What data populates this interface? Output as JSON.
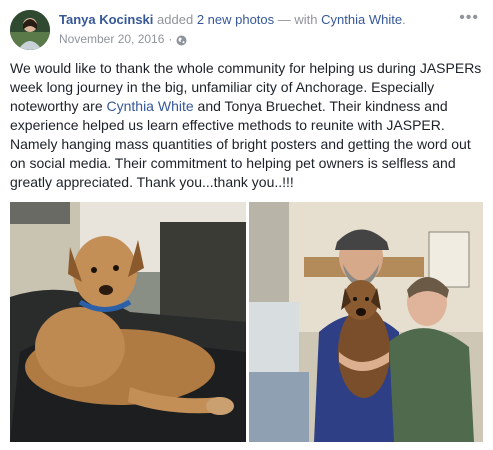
{
  "post": {
    "author": "Tanya Kocinski",
    "action_prefix": "added",
    "photo_count_link": "2 new photos",
    "with_prefix": "— with",
    "tagged_user": "Cynthia White",
    "tagged_suffix": ".",
    "date": "November 20, 2016",
    "separator": "·",
    "privacy_icon": "globe-icon",
    "more_label": "•••"
  },
  "content": {
    "p1": "We would like to thank the whole community for helping us during JASPERs week long journey in the big, unfamiliar city of Anchorage. Especially noteworthy are ",
    "tag1": "Cynthia White",
    "p2": " and Tonya Bruechet. Their kindness and experience helped us learn effective methods to reunite with JASPER. Namely hanging mass quantities of bright posters and getting the word out on social media. Their commitment to helping pet owners is selfless and greatly appreciated. Thank you...thank you..!!!"
  },
  "colors": {
    "link": "#365899",
    "meta": "#90949c",
    "text": "#1d2129"
  }
}
